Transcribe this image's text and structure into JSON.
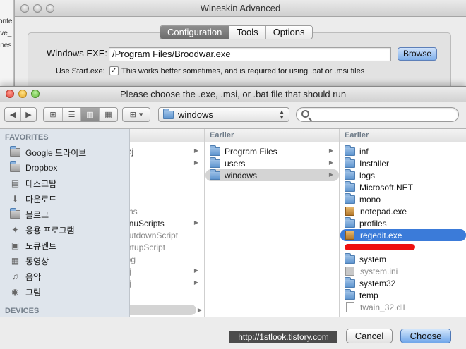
{
  "background_list": [
    "onte",
    "ive_",
    "ines"
  ],
  "wineskin": {
    "title": "Wineskin Advanced",
    "tabs": [
      "Configuration",
      "Tools",
      "Options"
    ],
    "exe_label": "Windows EXE:",
    "exe_value": "/Program Files/Broodwar.exe",
    "browse_label": "Browse",
    "start_label": "Use Start.exe:",
    "start_checked": "✓",
    "start_desc": "This works better sometimes, and is required for using .bat or .msi files"
  },
  "dialog": {
    "title": "Please choose the .exe, .msi, or .bat file that should run",
    "path_value": "windows"
  },
  "sidebar": {
    "favorites_label": "FAVORITES",
    "items": [
      {
        "label": "Google 드라이브",
        "icon": "folder-icon"
      },
      {
        "label": "Dropbox",
        "icon": "folder-icon"
      },
      {
        "label": "데스크탑",
        "icon": "desktop-icon"
      },
      {
        "label": "다운로드",
        "icon": "download-icon"
      },
      {
        "label": "블로그",
        "icon": "folder-icon"
      },
      {
        "label": "응용 프로그램",
        "icon": "applications-icon"
      },
      {
        "label": "도큐멘트",
        "icon": "documents-icon"
      },
      {
        "label": "동영상",
        "icon": "movies-icon"
      },
      {
        "label": "음악",
        "icon": "music-icon"
      },
      {
        "label": "그림",
        "icon": "pictures-icon"
      }
    ],
    "devices_label": "DEVICES"
  },
  "col1": {
    "rows": [
      "roj",
      "",
      "",
      "",
      "g",
      "cns",
      "enuScripts",
      "hutdownScript",
      "artupScript",
      "log",
      "oj",
      "oj"
    ]
  },
  "col2": {
    "header": "Earlier",
    "rows": [
      "Program Files",
      "users",
      "windows"
    ]
  },
  "col3": {
    "header": "Earlier",
    "rows": [
      "inf",
      "Installer",
      "logs",
      "Microsoft.NET",
      "mono",
      "notepad.exe",
      "profiles",
      "regedit.exe",
      "",
      "system",
      "system.ini",
      "system32",
      "temp",
      "twain_32.dll"
    ]
  },
  "bottom": {
    "watermark": "http://1stlook.tistory.com",
    "cancel_label": "Cancel",
    "choose_label": "Choose"
  }
}
